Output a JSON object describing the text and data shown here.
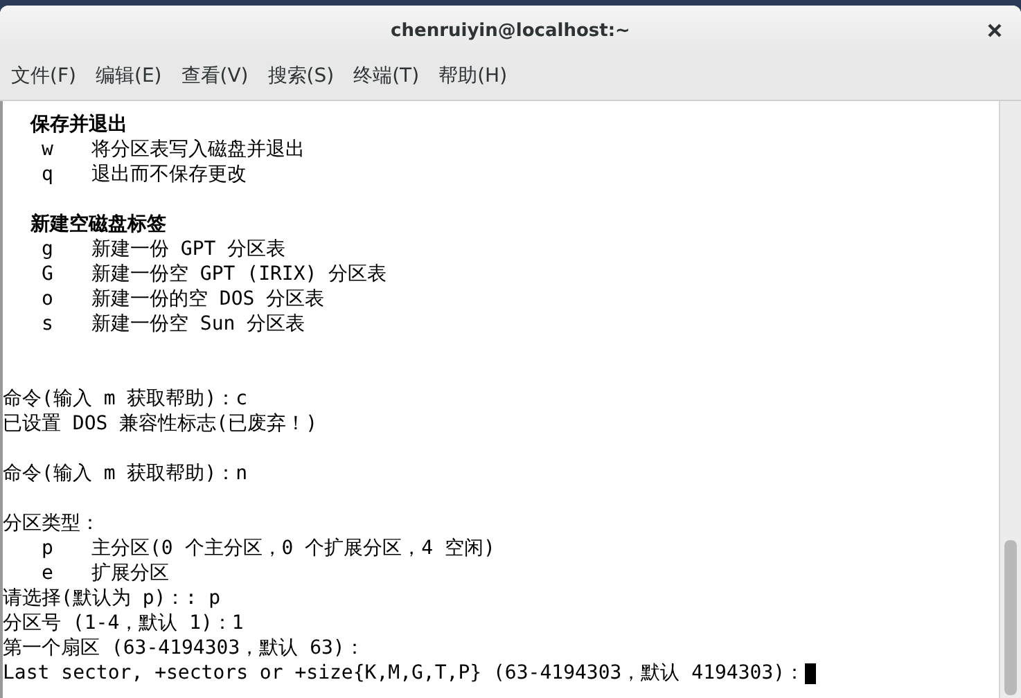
{
  "window": {
    "title": "chenruiyin@localhost:~"
  },
  "menu": [
    "文件(F)",
    "编辑(E)",
    "查看(V)",
    "搜索(S)",
    "终端(T)",
    "帮助(H)"
  ],
  "terminal": {
    "lines": [
      {
        "kind": "heading",
        "text": "保存并退出"
      },
      {
        "kind": "option",
        "key": "w",
        "text": "将分区表写入磁盘并退出"
      },
      {
        "kind": "option",
        "key": "q",
        "text": "退出而不保存更改"
      },
      {
        "kind": "blank"
      },
      {
        "kind": "heading",
        "text": "新建空磁盘标签"
      },
      {
        "kind": "option",
        "key": "g",
        "text": "新建一份 GPT 分区表"
      },
      {
        "kind": "option",
        "key": "G",
        "text": "新建一份空 GPT (IRIX) 分区表"
      },
      {
        "kind": "option",
        "key": "o",
        "text": "新建一份的空 DOS 分区表"
      },
      {
        "kind": "option",
        "key": "s",
        "text": "新建一份空 Sun 分区表"
      },
      {
        "kind": "blank"
      },
      {
        "kind": "blank"
      },
      {
        "kind": "output",
        "text": "命令(输入 m 获取帮助)：c"
      },
      {
        "kind": "output",
        "text": "已设置 DOS 兼容性标志(已废弃！)"
      },
      {
        "kind": "blank"
      },
      {
        "kind": "output",
        "text": "命令(输入 m 获取帮助)：n"
      },
      {
        "kind": "blank"
      },
      {
        "kind": "output",
        "text": "分区类型："
      },
      {
        "kind": "option",
        "key": "p",
        "text": "主分区(0 个主分区，0 个扩展分区，4 空闲)"
      },
      {
        "kind": "option",
        "key": "e",
        "text": "扩展分区"
      },
      {
        "kind": "output",
        "text": "请选择(默认为 p)：: p"
      },
      {
        "kind": "output",
        "text": "分区号 (1-4，默认 1)：1"
      },
      {
        "kind": "output",
        "text": "第一个扇区 (63-4194303，默认 63)："
      },
      {
        "kind": "prompt",
        "text": "Last sector, +sectors or +size{K,M,G,T,P} (63-4194303，默认 4194303)："
      }
    ]
  }
}
